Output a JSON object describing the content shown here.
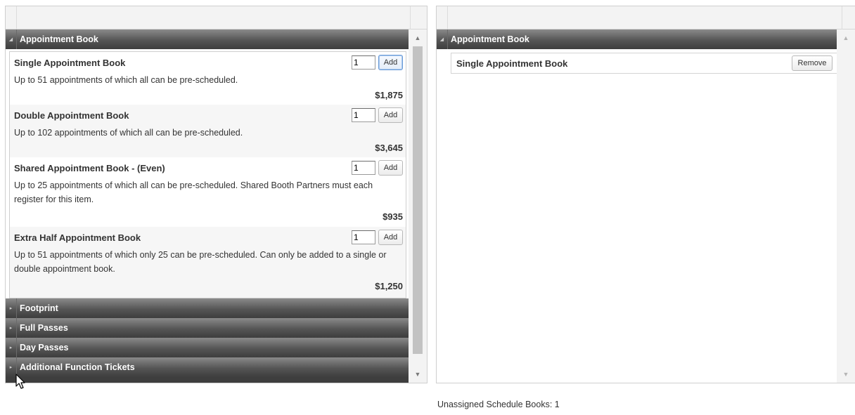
{
  "catalog": {
    "header": "Appointment Book",
    "items": [
      {
        "name": "Single Appointment Book",
        "description": "Up to 51 appointments of which all can be pre-scheduled.",
        "price": "$1,875",
        "qty": "1",
        "add_label": "Add"
      },
      {
        "name": "Double Appointment Book",
        "description": "Up to 102 appointments of which all can be pre-scheduled.",
        "price": "$3,645",
        "qty": "1",
        "add_label": "Add"
      },
      {
        "name": "Shared Appointment Book - (Even)",
        "description": "Up to 25 appointments of which all can be pre-scheduled. Shared Booth Partners must each register for this item.",
        "price": "$935",
        "qty": "1",
        "add_label": "Add"
      },
      {
        "name": "Extra Half Appointment Book",
        "description": "Up to 51 appointments of which only 25 can be pre-scheduled. Can only be added to a single or double appointment book.",
        "price": "$1,250",
        "qty": "1",
        "add_label": "Add"
      }
    ],
    "categories": [
      {
        "label": "Footprint"
      },
      {
        "label": "Full Passes"
      },
      {
        "label": "Day Passes"
      },
      {
        "label": "Additional Function Tickets"
      }
    ]
  },
  "cart": {
    "header": "Appointment Book",
    "items": [
      {
        "name": "Single Appointment Book",
        "remove_label": "Remove"
      }
    ]
  },
  "status": {
    "unassigned": "Unassigned Schedule Books: 1"
  },
  "colors": {
    "header_bar": "#555555",
    "focus_border": "#6b9bd6"
  }
}
